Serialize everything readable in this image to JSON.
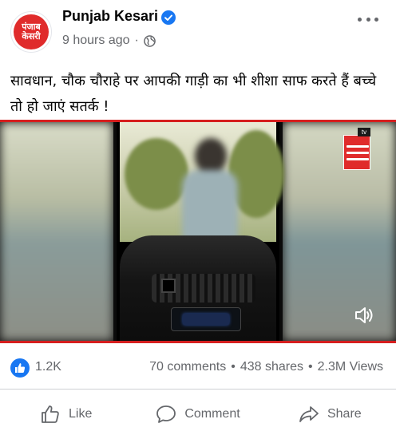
{
  "post": {
    "page_name": "Punjab Kesari",
    "time_ago": "9 hours ago",
    "separator": "·",
    "caption": "सावधान, चौक चौराहे पर आपकी गाड़ी का भी शीशा साफ करते हैं बच्चे तो हो जाएं सतर्क !",
    "avatar_logo_line1": "पंजाब",
    "avatar_logo_line2": "केसरी"
  },
  "video": {
    "channel_logo": "tv-channel-logo",
    "tv_tag": "tv",
    "muted_icon": "speaker-icon"
  },
  "engagement": {
    "reactions": "1.2K",
    "comments": "70 comments",
    "shares": "438 shares",
    "views": "2.3M Views",
    "dot": "•"
  },
  "actions": {
    "like": "Like",
    "comment": "Comment",
    "share": "Share"
  },
  "colors": {
    "brand_blue": "#1877f2",
    "secondary_text": "#65676b",
    "logo_red": "#e02b2b"
  }
}
